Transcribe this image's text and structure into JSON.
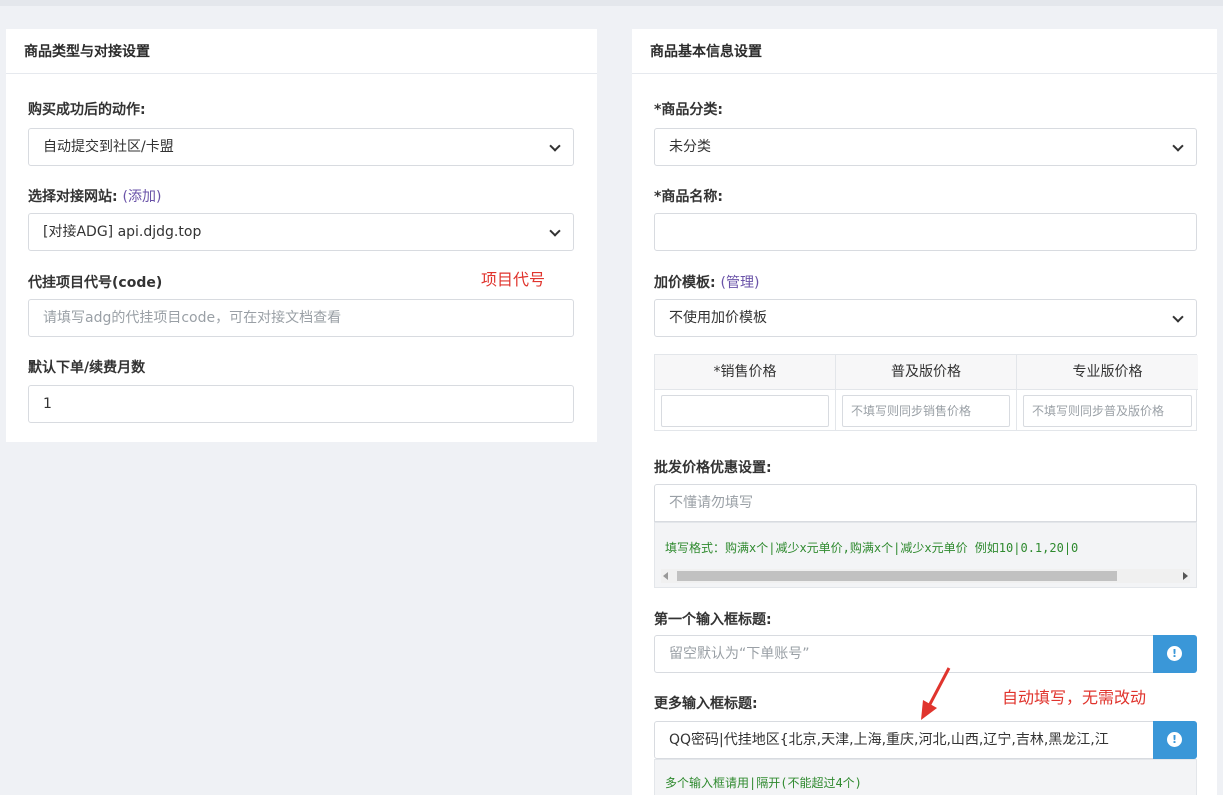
{
  "left_panel": {
    "title": "商品类型与对接设置",
    "action": {
      "label": "购买成功后的动作:",
      "value": "自动提交到社区/卡盟"
    },
    "site": {
      "label": "选择对接网站:",
      "link": "(添加)",
      "value": "[对接ADG] api.djdg.top"
    },
    "code": {
      "label": "代挂项目代号(code)",
      "placeholder": "请填写adg的代挂项目code，可在对接文档查看"
    },
    "months": {
      "label": "默认下单/续费月数",
      "value": "1"
    },
    "annotation": "项目代号"
  },
  "right_panel": {
    "title": "商品基本信息设置",
    "category": {
      "label": "*商品分类:",
      "value": "未分类"
    },
    "name": {
      "label": "*商品名称:",
      "value": ""
    },
    "markup": {
      "label": "加价模板:",
      "link": "(管理)",
      "value": "不使用加价模板"
    },
    "price_table": {
      "headers": [
        "*销售价格",
        "普及版价格",
        "专业版价格"
      ],
      "placeholders": [
        "",
        "不填写则同步销售价格",
        "不填写则同步普及版价格"
      ]
    },
    "wholesale": {
      "label": "批发价格优惠设置:",
      "placeholder": "不懂请勿填写",
      "hint": "填写格式：购满x个|减少x元单价,购满x个|减少x元单价  例如10|0.1,20|0"
    },
    "first_input": {
      "label": "第一个输入框标题:",
      "placeholder": "留空默认为“下单账号”"
    },
    "more_inputs": {
      "label": "更多输入框标题:",
      "value": "QQ密码|代挂地区{北京,天津,上海,重庆,河北,山西,辽宁,吉林,黑龙江,江",
      "hint": "多个输入框请用|隔开(不能超过4个)"
    },
    "annotation": "自动填写，无需改动"
  },
  "colors": {
    "accent": "#3a97d8",
    "annotation_red": "#e0342d",
    "hint_green": "#2f8a2f",
    "link_purple": "#6a53a8"
  },
  "icons": {
    "info_button": "exclamation-circle-icon",
    "select_arrow": "chevron-down-icon"
  }
}
